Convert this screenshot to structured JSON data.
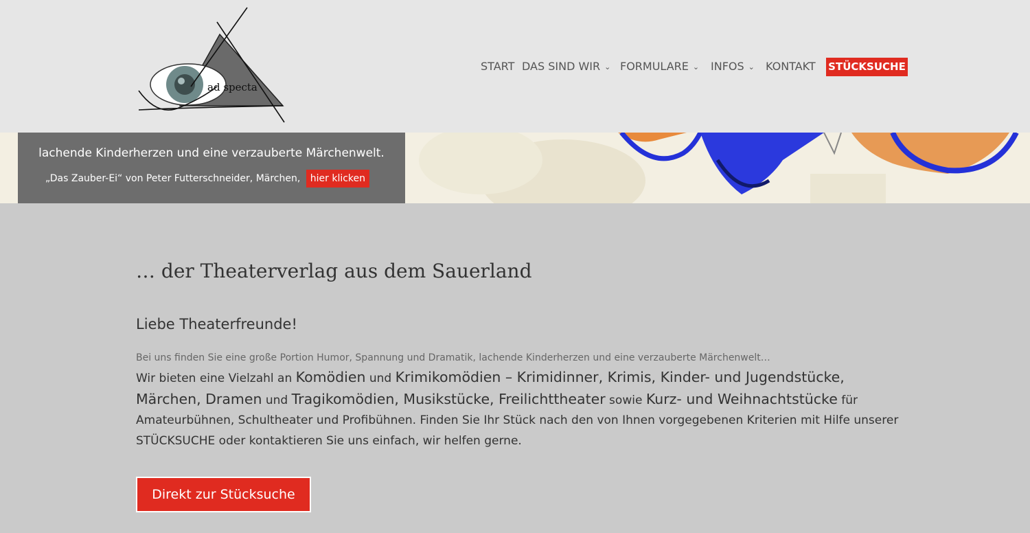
{
  "brand": {
    "logo_text": "ad specta"
  },
  "nav": {
    "items": [
      {
        "label": "START"
      },
      {
        "label": "DAS SIND WIR"
      },
      {
        "label": "FORMULARE"
      },
      {
        "label": "INFOS"
      },
      {
        "label": "KONTAKT"
      },
      {
        "label": "STÜCKSUCHE"
      }
    ],
    "chevron": "⌄"
  },
  "banner": {
    "line1": "lachende Kinderherzen und eine verzauberte Märchenwelt.",
    "line2": "„Das Zauber-Ei“ von Peter Futterschneider, Märchen,",
    "link_label": "hier klicken"
  },
  "main": {
    "tagline": "… der Theaterverlag aus dem Sauerland",
    "greeting": "Liebe Theaterfreunde!",
    "intro": "Bei uns finden Sie eine große Portion Humor, Spannung und Dramatik, lachende Kinderherzen und eine verzauberte Märchenwelt…",
    "body": {
      "p1": "Wir bieten eine Vielzahl an ",
      "b1": "Komödien",
      "p2": " und ",
      "b2": "Krimikomödien – Krimidinner, Krimis, Kinder- und Jugendstücke, Märchen, Dramen",
      "p3": " und ",
      "b3": "Tragikomödien, Musikstücke, Freilichttheater",
      "p4": " sowie ",
      "b4": "Kurz- und Weihnachtstücke",
      "p5": " für Amateurbühnen, Schultheater und Profibühnen. Finden Sie Ihr Stück nach den von Ihnen vorgegebenen Kriterien mit Hilfe unserer STÜCKSUCHE oder kontaktieren Sie uns einfach, wir helfen gerne."
    },
    "cta_label": "Direkt zur Stücksuche"
  },
  "colors": {
    "accent": "#e02b20",
    "header_bg": "#e6e6e6",
    "page_bg": "#cacaca",
    "banner_box": "#6d6d6d"
  }
}
